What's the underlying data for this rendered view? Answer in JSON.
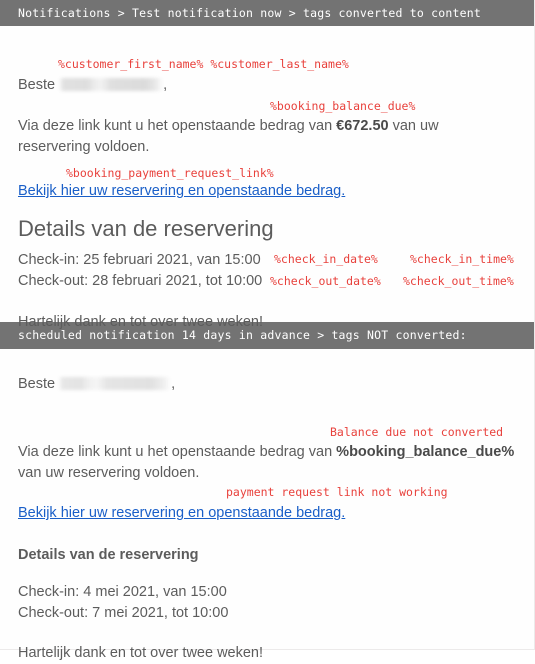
{
  "section1": {
    "banner": "Notifications > Test notification now > tags converted to content",
    "tag_customer_name": "%customer_first_name% %customer_last_name%",
    "greeting_prefix": "Beste",
    "greeting_redacted_name": "",
    "greeting_suffix": ",",
    "tag_balance_due": "%booking_balance_due%",
    "paragraph_before_amount": "Via deze link kunt u het openstaande bedrag van ",
    "amount": "€672.50",
    "paragraph_after_amount": " van uw reservering voldoen.",
    "tag_payment_link": "%booking_payment_request_link%",
    "link_text": "Bekijk hier uw reservering en openstaande bedrag.",
    "details_heading": "Details van de reservering",
    "check_in_line": "Check-in: 25 februari 2021, van 15:00",
    "check_out_line": "Check-out: 28 februari 2021, tot 10:00",
    "tag_check_in_date": "%check_in_date%",
    "tag_check_in_time": "%check_in_time%",
    "tag_check_out_date": "%check_out_date%",
    "tag_check_out_time": "%check_out_time%",
    "closing": "Hartelijk dank en tot over twee weken!"
  },
  "section2": {
    "banner": "scheduled notification 14 days in advance > tags NOT converted:",
    "greeting_prefix": "Beste",
    "greeting_redacted_name": "",
    "greeting_suffix": ",",
    "annotation_balance": "Balance due not converted",
    "paragraph_before_tag": "Via deze link kunt u het openstaande bedrag van ",
    "unconverted_balance_tag": "%booking_balance_due%",
    "paragraph_after_tag": "van uw reservering voldoen.",
    "annotation_payment_link": "payment request link not working",
    "link_text": "Bekijk hier uw reservering en openstaande bedrag.",
    "details_heading": "Details van de reservering",
    "check_in_line": "Check-in: 4 mei 2021, van 15:00",
    "check_out_line": "Check-out: 7 mei 2021, tot 10:00",
    "closing": "Hartelijk dank en tot over twee weken!"
  },
  "colors": {
    "banner_bg": "#737373",
    "banner_text": "#ffffff",
    "annotation_red": "#e8413c",
    "link_blue": "#1a5fc8",
    "body_text": "#5c5c5c",
    "page_bg": "#fefefe"
  }
}
